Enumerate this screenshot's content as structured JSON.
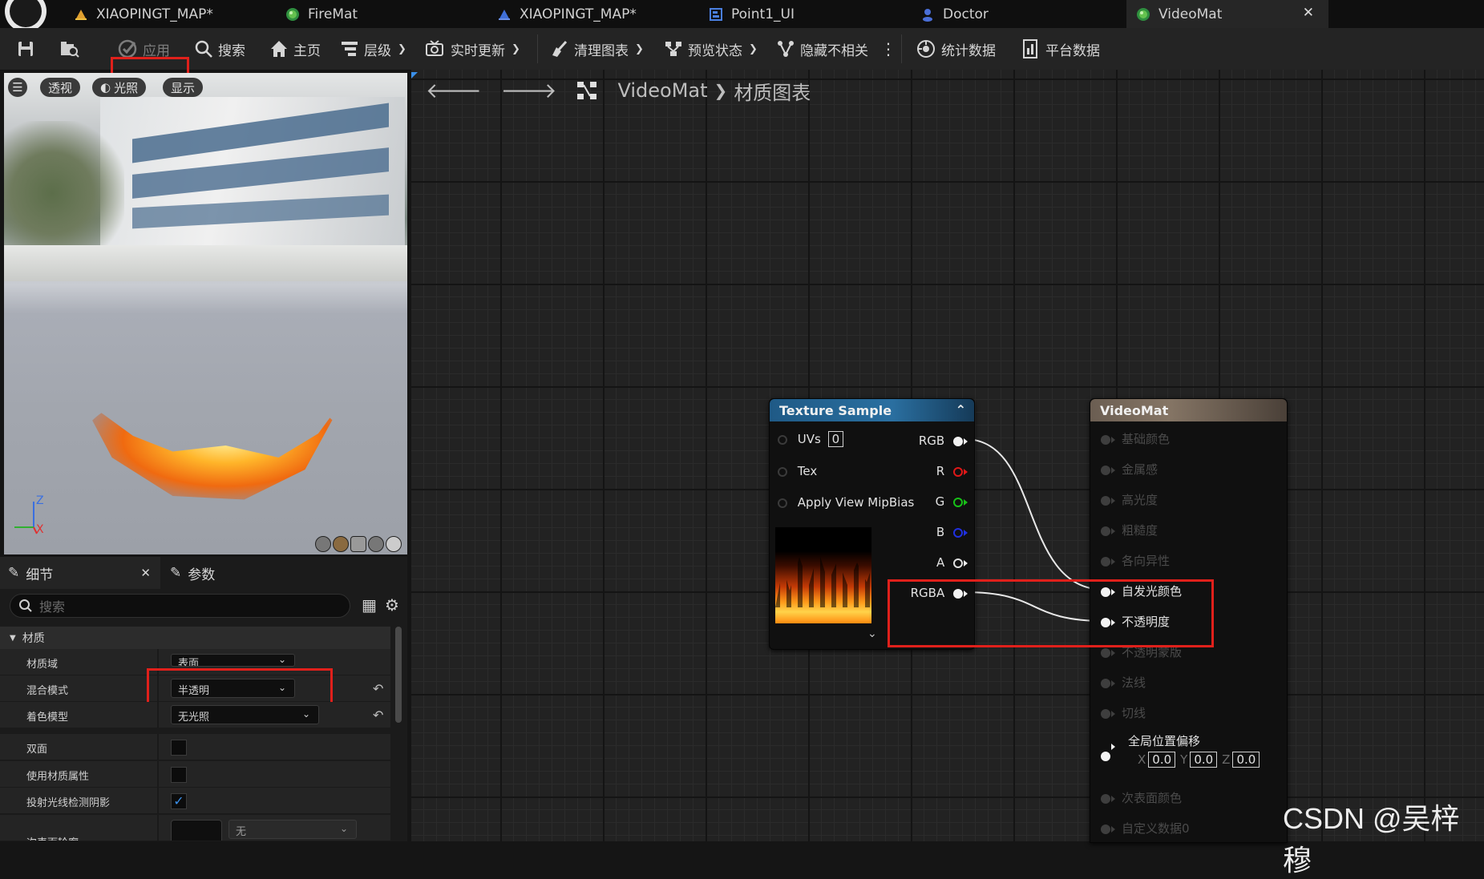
{
  "tabs": [
    {
      "label": "XIAOPINGT_MAP*",
      "icon": "level-map-icon"
    },
    {
      "label": "FireMat",
      "icon": "material-icon"
    },
    {
      "label": "XIAOPINGT_MAP*",
      "icon": "level-map-icon"
    },
    {
      "label": "Point1_UI",
      "icon": "widget-blueprint-icon"
    },
    {
      "label": "Doctor",
      "icon": "character-icon"
    },
    {
      "label": "VideoMat",
      "icon": "material-icon",
      "active": true
    }
  ],
  "toolbar": {
    "apply": "应用",
    "search": "搜索",
    "home": "主页",
    "hierarchy": "层级",
    "live_update": "实时更新",
    "clean_graph": "清理图表",
    "preview_state": "预览状态",
    "hide_unrelated": "隐藏不相关",
    "stats": "统计数据",
    "platform_stats": "平台数据"
  },
  "viewport": {
    "perspective": "透视",
    "lighting": "光照",
    "show": "显示",
    "axis_z": "Z",
    "axis_x": "X"
  },
  "details": {
    "tab_details": "细节",
    "tab_params": "参数",
    "search_placeholder": "搜索",
    "section": "材质",
    "rows": [
      {
        "label": "材质域",
        "value": "表面"
      },
      {
        "label": "混合模式",
        "value": "半透明"
      },
      {
        "label": "着色模型",
        "value": "无光照"
      },
      {
        "label": "双面"
      },
      {
        "label": "使用材质属性"
      },
      {
        "label": "投射光线检测阴影",
        "checked": true
      },
      {
        "label": "次表面轮廓",
        "value": "无"
      }
    ]
  },
  "graph": {
    "breadcrumb_root": "VideoMat",
    "breadcrumb_child": "材质图表",
    "texture_node": {
      "title": "Texture Sample",
      "inputs": [
        "UVs",
        "Tex",
        "Apply View MipBias"
      ],
      "uv_value": "0",
      "outputs": [
        "RGB",
        "R",
        "G",
        "B",
        "A",
        "RGBA"
      ],
      "output_colors": [
        "#f2f2f2",
        "#e01818",
        "#18c018",
        "#2030e0",
        "#f2f2f2",
        "#f2f2f2"
      ]
    },
    "result_node": {
      "title": "VideoMat",
      "pins": [
        {
          "label": "基础颜色",
          "active": false
        },
        {
          "label": "金属感",
          "active": false
        },
        {
          "label": "高光度",
          "active": false
        },
        {
          "label": "粗糙度",
          "active": false
        },
        {
          "label": "各向异性",
          "active": false
        },
        {
          "label": "自发光颜色",
          "active": true
        },
        {
          "label": "不透明度",
          "active": true
        },
        {
          "label": "不透明蒙版",
          "active": false
        },
        {
          "label": "法线",
          "active": false
        },
        {
          "label": "切线",
          "active": false
        },
        {
          "label": "全局位置偏移",
          "active": true
        },
        {
          "label": "次表面颜色",
          "active": false
        },
        {
          "label": "自定义数据0",
          "active": false
        }
      ],
      "wpo": {
        "x": "0.0",
        "y": "0.0",
        "z": "0.0",
        "x_label": "X",
        "y_label": "Y",
        "z_label": "Z"
      }
    }
  },
  "watermark": "CSDN @吴梓穆",
  "colors": {
    "highlight_red": "#e0201b",
    "texture_header": "#1f5a86",
    "result_header": "#6b5e52"
  }
}
